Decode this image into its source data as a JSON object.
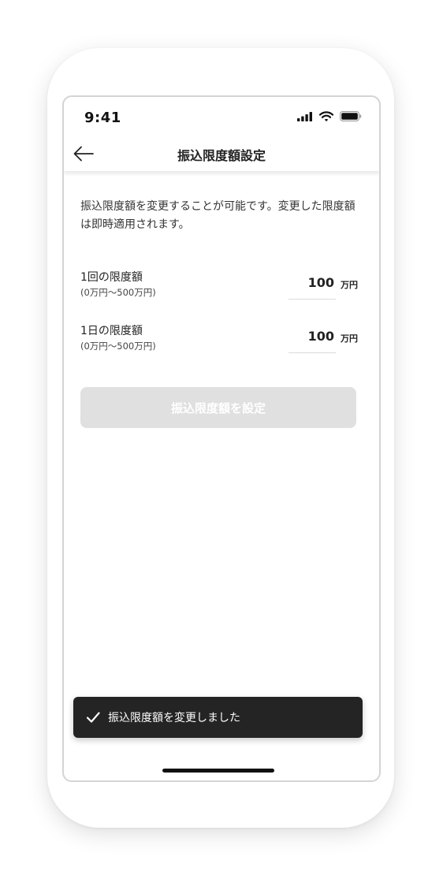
{
  "status_bar": {
    "time": "9:41",
    "icons": [
      "signal-icon",
      "wifi-icon",
      "battery-icon"
    ]
  },
  "nav": {
    "back_icon": "arrow-left-icon",
    "title": "振込限度額設定"
  },
  "description": "振込限度額を変更することが可能です。変更した限度額は即時適用されます。",
  "limits": [
    {
      "label": "1回の限度額",
      "range": "(0万円〜500万円)",
      "value": "100",
      "unit": "万円"
    },
    {
      "label": "1日の限度額",
      "range": "(0万円〜500万円)",
      "value": "100",
      "unit": "万円"
    }
  ],
  "submit_button": {
    "label": "振込限度額を設定",
    "state": "disabled"
  },
  "toast": {
    "icon": "check-icon",
    "message": "振込限度額を変更しました"
  },
  "colors": {
    "toast_background": "#242424",
    "disabled_button": "#e0e0e0",
    "text_primary": "#222222"
  }
}
